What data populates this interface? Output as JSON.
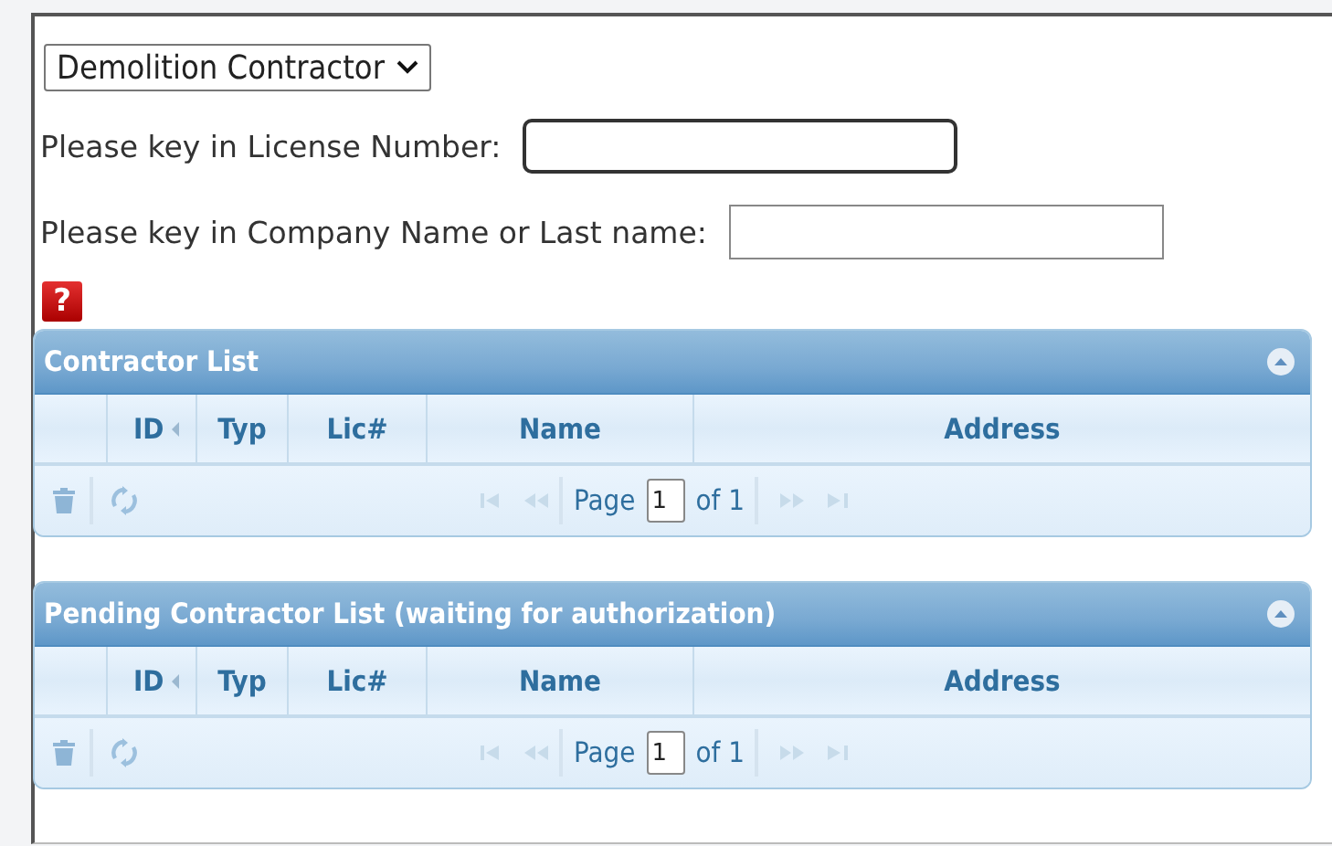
{
  "contractor_type": {
    "value": "Demolition Contractor"
  },
  "license_field": {
    "label": "Please key in License Number:",
    "focused": true
  },
  "company_field": {
    "label": "Please key in Company Name or Last name:",
    "focused": false
  },
  "help_button": {
    "glyph": "?"
  },
  "grids": [
    {
      "title": "Contractor List",
      "expanded": true,
      "columns": [
        {
          "label": "ID",
          "sorted": true
        },
        {
          "label": "Typ",
          "sorted": false
        },
        {
          "label": "Lic#",
          "sorted": false
        },
        {
          "label": "Name",
          "sorted": false
        },
        {
          "label": "Address",
          "sorted": false
        }
      ],
      "pager": {
        "page_label": "Page",
        "page": "1",
        "of": "of 1"
      }
    },
    {
      "title": "Pending Contractor List (waiting for authorization)",
      "expanded": true,
      "columns": [
        {
          "label": "ID",
          "sorted": true
        },
        {
          "label": "Typ",
          "sorted": false
        },
        {
          "label": "Lic#",
          "sorted": false
        },
        {
          "label": "Name",
          "sorted": false
        },
        {
          "label": "Address",
          "sorted": false
        }
      ],
      "pager": {
        "page_label": "Page",
        "page": "1",
        "of": "of 1"
      }
    }
  ]
}
